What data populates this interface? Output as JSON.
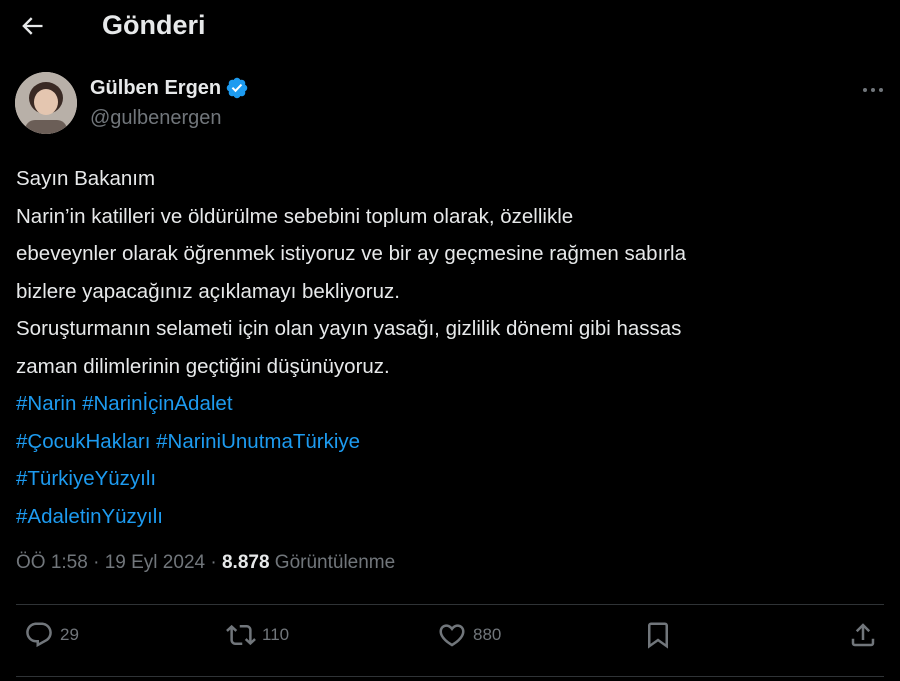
{
  "header": {
    "title": "Gönderi",
    "back_icon": "arrow-left-icon"
  },
  "author": {
    "name": "Gülben Ergen",
    "handle": "@gulbenergen",
    "verified_color": "#1d9bf0"
  },
  "tweet": {
    "lines": [
      "Sayın Bakanım",
      "Narin’in katilleri ve öldürülme sebebini toplum olarak, özellikle",
      "ebeveynler olarak öğrenmek istiyoruz ve bir ay geçmesine rağmen sabırla",
      "bizlere yapacağınız açıklamayı bekliyoruz.",
      "Soruşturmanın selameti için olan yayın yasağı, gizlilik dönemi gibi hassas",
      "zaman dilimlerinin geçtiğini düşünüyoruz."
    ],
    "hashtag_lines": [
      [
        "#Narin",
        "#NarinİçinAdalet"
      ],
      [
        "#ÇocukHakları",
        "#NariniUnutmaTürkiye"
      ],
      [
        "#TürkiyeYüzyılı"
      ],
      [
        "#AdaletinYüzyılı"
      ]
    ]
  },
  "meta": {
    "time": "ÖÖ 1:58",
    "sep1": " · ",
    "date": "19 Eyl 2024",
    "sep2": " · ",
    "views": "8.878",
    "views_label": " Görüntülenme"
  },
  "actions": {
    "replies": "29",
    "reposts": "110",
    "likes": "880"
  },
  "colors": {
    "background": "#000000",
    "text": "#e7e9ea",
    "muted": "#71767b",
    "link": "#1d9bf0"
  }
}
